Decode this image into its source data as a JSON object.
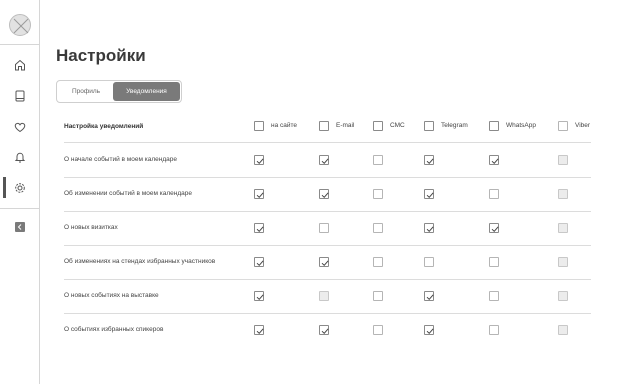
{
  "page": {
    "title": "Настройки"
  },
  "tabs": [
    {
      "label": "Профиль",
      "active": false
    },
    {
      "label": "Уведомления",
      "active": true
    }
  ],
  "sidebar": {
    "items": [
      {
        "icon": "home-icon"
      },
      {
        "icon": "book-icon"
      },
      {
        "icon": "heart-icon"
      },
      {
        "icon": "bell-icon"
      },
      {
        "icon": "gear-icon",
        "active": true
      }
    ],
    "collapse_icon": "chevron-left-icon"
  },
  "table": {
    "header_label": "Настройка уведомлений",
    "columns": [
      {
        "label": "на сайте",
        "checked": true
      },
      {
        "label": "E-mail",
        "checked": true
      },
      {
        "label": "СМС",
        "checked": true
      },
      {
        "label": "Telegram",
        "checked": true
      },
      {
        "label": "WhatsApp",
        "checked": true
      },
      {
        "label": "Viber",
        "checked": false
      }
    ],
    "rows": [
      {
        "label": "О начале событий в моем календаре",
        "values": [
          "checked",
          "checked",
          "unchecked",
          "checked",
          "checked",
          "disabled"
        ]
      },
      {
        "label": "Об изменении событий в моем календаре",
        "values": [
          "checked",
          "checked",
          "unchecked",
          "checked",
          "unchecked",
          "disabled"
        ]
      },
      {
        "label": "О новых визитках",
        "values": [
          "checked",
          "unchecked",
          "unchecked",
          "checked",
          "checked",
          "disabled"
        ]
      },
      {
        "label": "Об изменениях на стендах избранных участников",
        "values": [
          "checked",
          "checked",
          "unchecked",
          "unchecked",
          "unchecked",
          "disabled"
        ]
      },
      {
        "label": "О новых событиях на выставке",
        "values": [
          "checked",
          "disabled",
          "unchecked",
          "checked",
          "unchecked",
          "disabled"
        ]
      },
      {
        "label": "О событиях избранных спикеров",
        "values": [
          "checked",
          "checked",
          "unchecked",
          "checked",
          "unchecked",
          "disabled"
        ]
      }
    ]
  },
  "colors": {
    "accent": "#7a7a7a",
    "border": "#d6d6d6",
    "text": "#333333"
  }
}
